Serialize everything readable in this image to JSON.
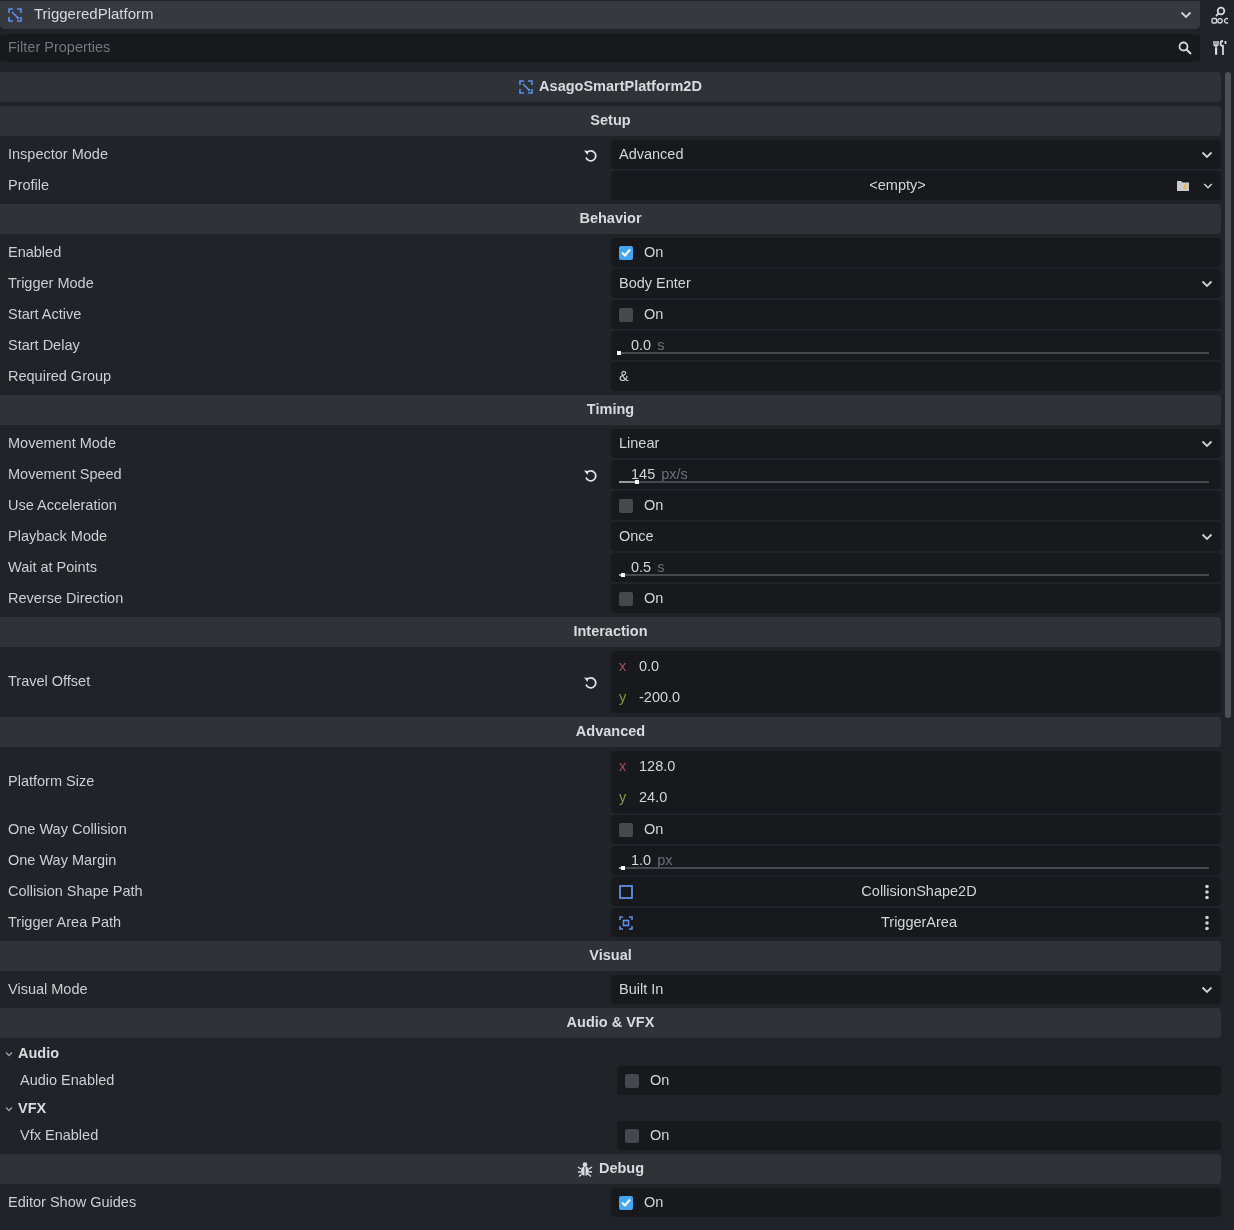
{
  "header": {
    "node": "TriggeredPlatform"
  },
  "filter": {
    "placeholder": "Filter Properties"
  },
  "class_title": "AsagoSmartPlatform2D",
  "sections": [
    {
      "title": "Setup",
      "rows": [
        {
          "kind": "enum",
          "label": "Inspector Mode",
          "revert": true,
          "value": "Advanced"
        },
        {
          "kind": "resource",
          "label": "Profile",
          "revert": false,
          "value": "<empty>"
        }
      ]
    },
    {
      "title": "Behavior",
      "rows": [
        {
          "kind": "check",
          "label": "Enabled",
          "revert": false,
          "checked": true,
          "value": "On"
        },
        {
          "kind": "enum",
          "label": "Trigger Mode",
          "revert": false,
          "value": "Body Enter"
        },
        {
          "kind": "check",
          "label": "Start Active",
          "revert": false,
          "checked": false,
          "value": "On"
        },
        {
          "kind": "slider",
          "label": "Start Delay",
          "revert": false,
          "value": "0.0",
          "unit": "s",
          "level": 0
        },
        {
          "kind": "text",
          "label": "Required Group",
          "revert": false,
          "value": "&"
        }
      ]
    },
    {
      "title": "Timing",
      "rows": [
        {
          "kind": "enum",
          "label": "Movement Mode",
          "revert": false,
          "value": "Linear"
        },
        {
          "kind": "slider",
          "label": "Movement Speed",
          "revert": true,
          "value": "145",
          "unit": "px/s",
          "level": 0.03
        },
        {
          "kind": "check",
          "label": "Use Acceleration",
          "revert": false,
          "checked": false,
          "value": "On"
        },
        {
          "kind": "enum",
          "label": "Playback Mode",
          "revert": false,
          "value": "Once"
        },
        {
          "kind": "slider",
          "label": "Wait at Points",
          "revert": false,
          "value": "0.5",
          "unit": "s",
          "level": 0.006
        },
        {
          "kind": "check",
          "label": "Reverse Direction",
          "revert": false,
          "checked": false,
          "value": "On"
        }
      ]
    },
    {
      "title": "Interaction",
      "rows": [
        {
          "kind": "vector",
          "label": "Travel Offset",
          "revert": true,
          "components": [
            {
              "axis": "x",
              "value": "0.0"
            },
            {
              "axis": "y",
              "value": "-200.0"
            }
          ]
        }
      ]
    },
    {
      "title": "Advanced",
      "rows": [
        {
          "kind": "vector",
          "label": "Platform Size",
          "revert": false,
          "components": [
            {
              "axis": "x",
              "value": "128.0"
            },
            {
              "axis": "y",
              "value": "24.0"
            }
          ]
        },
        {
          "kind": "check",
          "label": "One Way Collision",
          "revert": false,
          "checked": false,
          "value": "On"
        },
        {
          "kind": "slider",
          "label": "One Way Margin",
          "revert": false,
          "value": "1.0",
          "unit": "px",
          "level": 0.006
        },
        {
          "kind": "shapepath",
          "label": "Collision Shape Path",
          "revert": false,
          "value": "CollisionShape2D"
        },
        {
          "kind": "areapath",
          "label": "Trigger Area Path",
          "revert": false,
          "value": "TriggerArea"
        }
      ]
    },
    {
      "title": "Visual",
      "rows": [
        {
          "kind": "enum",
          "label": "Visual Mode",
          "revert": false,
          "value": "Built In"
        }
      ]
    },
    {
      "title": "Audio & VFX",
      "groups": [
        {
          "title": "Audio",
          "expanded": true,
          "rows": [
            {
              "kind": "check",
              "label": "Audio Enabled",
              "revert": false,
              "checked": false,
              "value": "On"
            }
          ]
        },
        {
          "title": "VFX",
          "expanded": true,
          "rows": [
            {
              "kind": "check",
              "label": "Vfx Enabled",
              "revert": false,
              "checked": false,
              "value": "On"
            }
          ]
        }
      ]
    },
    {
      "title": "Debug",
      "rows": [
        {
          "kind": "check",
          "label": "Editor Show Guides",
          "revert": false,
          "checked": true,
          "value": "On"
        }
      ]
    }
  ]
}
